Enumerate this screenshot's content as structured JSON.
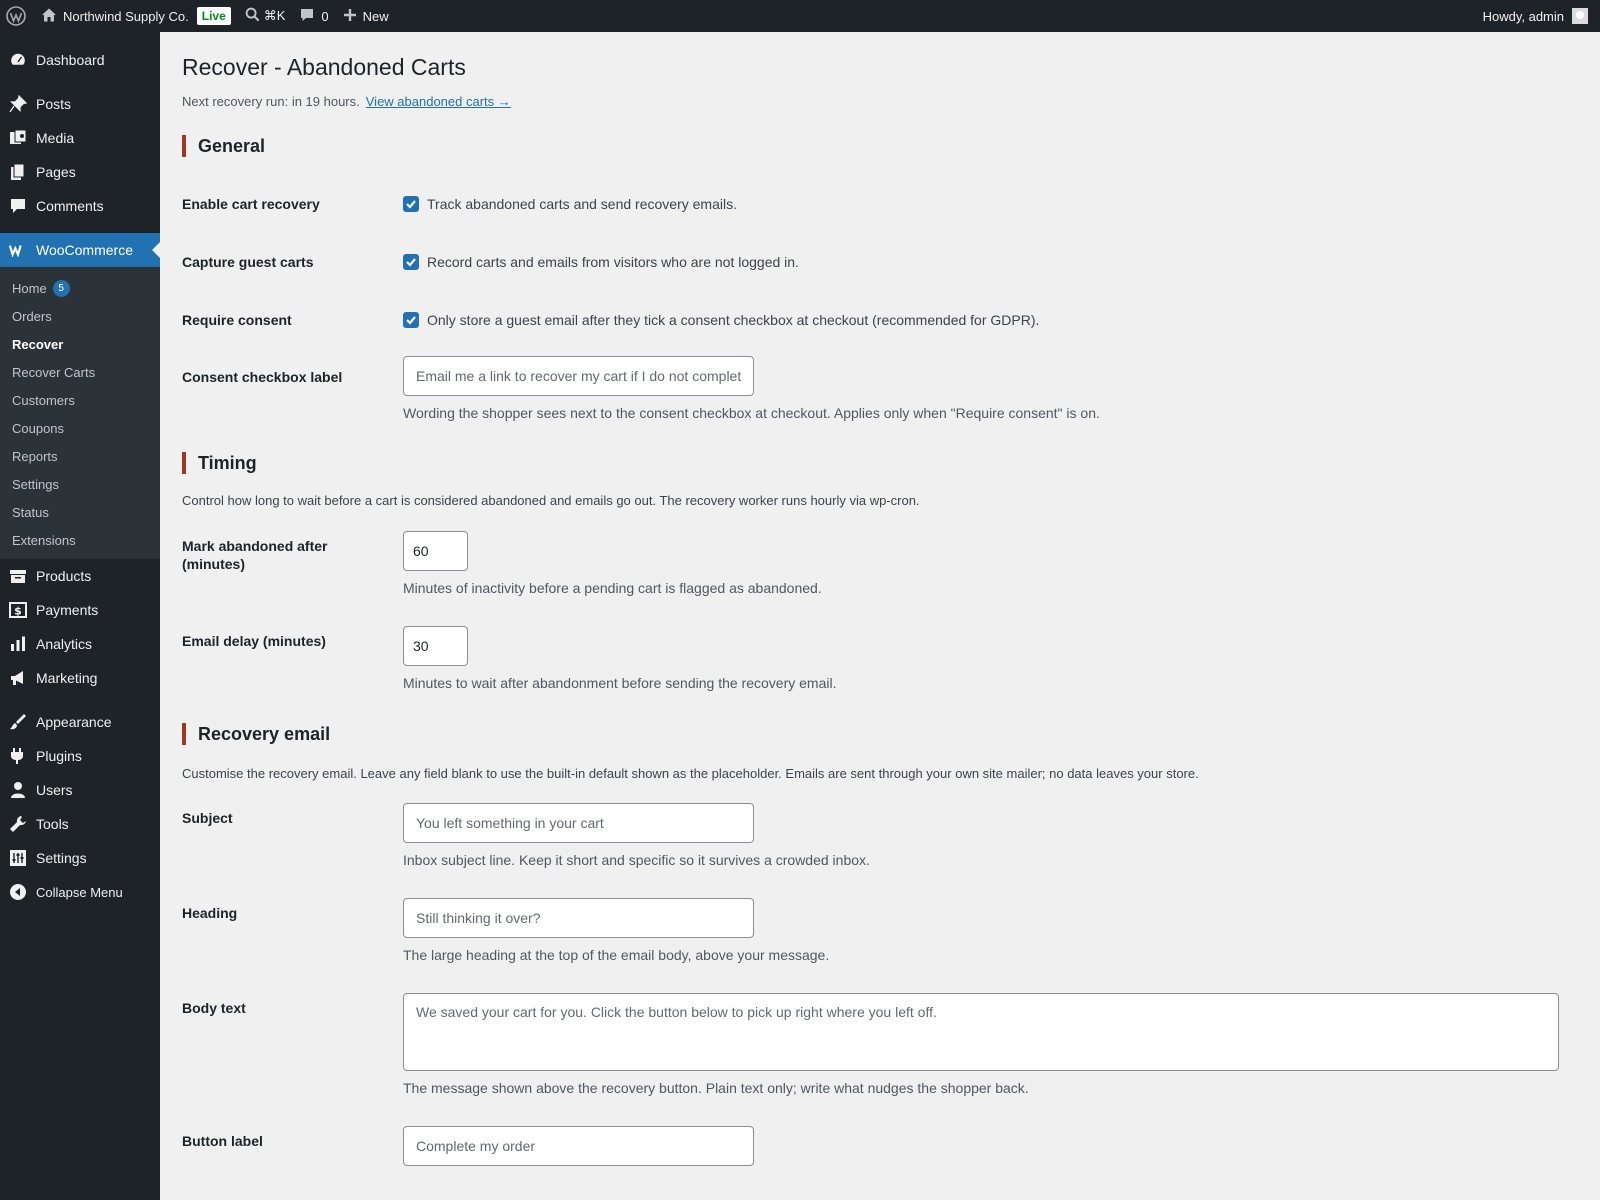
{
  "adminbar": {
    "site_name": "Northwind Supply Co.",
    "live_badge": "Live",
    "search_shortcut": "⌘K",
    "comments_count": "0",
    "new_label": "New",
    "howdy": "Howdy, admin"
  },
  "sidebar": {
    "dashboard": "Dashboard",
    "posts": "Posts",
    "media": "Media",
    "pages": "Pages",
    "comments": "Comments",
    "woocommerce": "WooCommerce",
    "woo_sub": [
      {
        "label": "Home",
        "badge": "5"
      },
      {
        "label": "Orders"
      },
      {
        "label": "Recover"
      },
      {
        "label": "Recover Carts"
      },
      {
        "label": "Customers"
      },
      {
        "label": "Coupons"
      },
      {
        "label": "Reports"
      },
      {
        "label": "Settings"
      },
      {
        "label": "Status"
      },
      {
        "label": "Extensions"
      }
    ],
    "products": "Products",
    "payments": "Payments",
    "analytics": "Analytics",
    "marketing": "Marketing",
    "appearance": "Appearance",
    "plugins": "Plugins",
    "users": "Users",
    "tools": "Tools",
    "settings": "Settings",
    "collapse": "Collapse Menu"
  },
  "page": {
    "title": "Recover - Abandoned Carts",
    "next_run": "Next recovery run: in 19 hours.",
    "view_link": "View abandoned carts →"
  },
  "general": {
    "heading": "General",
    "enable_label": "Enable cart recovery",
    "enable_text": "Track abandoned carts and send recovery emails.",
    "enable_checked": true,
    "guest_label": "Capture guest carts",
    "guest_text": "Record carts and emails from visitors who are not logged in.",
    "guest_checked": true,
    "consent_label": "Require consent",
    "consent_text": "Only store a guest email after they tick a consent checkbox at checkout (recommended for GDPR).",
    "consent_checked": true,
    "consent_cb_label": "Consent checkbox label",
    "consent_cb_placeholder": "Email me a link to recover my cart if I do not complete my order",
    "consent_cb_help": "Wording the shopper sees next to the consent checkbox at checkout. Applies only when \"Require consent\" is on."
  },
  "timing": {
    "heading": "Timing",
    "desc": "Control how long to wait before a cart is considered abandoned and emails go out. The recovery worker runs hourly via wp-cron.",
    "abandon_label": "Mark abandoned after (minutes)",
    "abandon_value": "60",
    "abandon_help": "Minutes of inactivity before a pending cart is flagged as abandoned.",
    "delay_label": "Email delay (minutes)",
    "delay_value": "30",
    "delay_help": "Minutes to wait after abandonment before sending the recovery email."
  },
  "email": {
    "heading": "Recovery email",
    "desc": "Customise the recovery email. Leave any field blank to use the built-in default shown as the placeholder. Emails are sent through your own site mailer; no data leaves your store.",
    "subject_label": "Subject",
    "subject_placeholder": "You left something in your cart",
    "subject_help": "Inbox subject line. Keep it short and specific so it survives a crowded inbox.",
    "heading_label": "Heading",
    "heading_placeholder": "Still thinking it over?",
    "heading_help": "The large heading at the top of the email body, above your message.",
    "body_label": "Body text",
    "body_placeholder": "We saved your cart for you. Click the button below to pick up right where you left off.",
    "body_help": "The message shown above the recovery button. Plain text only; write what nudges the shopper back.",
    "button_label": "Button label",
    "button_placeholder": "Complete my order"
  },
  "colors": {
    "accent": "#2271b1",
    "section_bar": "#a0381f",
    "live_green": "#008a20"
  }
}
